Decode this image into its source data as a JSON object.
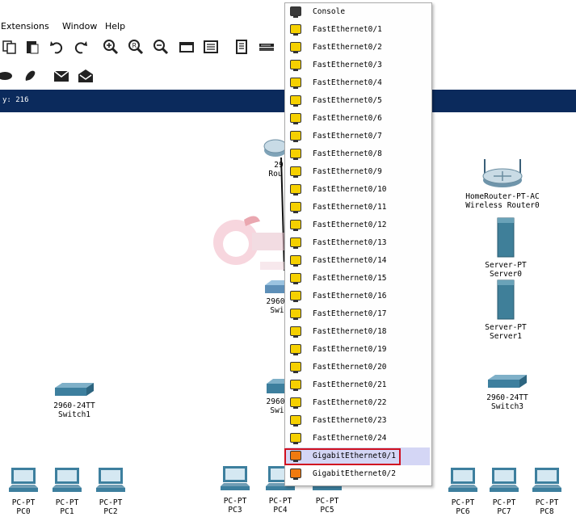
{
  "menu": {
    "extensions": "Extensions",
    "window": "Window",
    "help": "Help"
  },
  "toolbar_icons": [
    "copy-icon",
    "paste-icon",
    "undo-icon",
    "redo-icon",
    "zoom-in-icon",
    "zoom-reset-icon",
    "zoom-out-icon",
    "drawing-palette-icon",
    "custom-device-icon",
    "notes-icon",
    "cluster-icon"
  ],
  "toolbar2_icons": [
    "ellipse-icon",
    "freeform-icon",
    "add-pdu-icon",
    "add-complex-pdu-icon"
  ],
  "status": {
    "coord": "y: 216"
  },
  "devices": {
    "router_top_model": "29",
    "router_top_name": "Rou",
    "home_router_model": "HomeRouter-PT-AC",
    "home_router_name": "Wireless Router0",
    "server0_model": "Server-PT",
    "server0_name": "Server0",
    "server1_model": "Server-PT",
    "server1_name": "Server1",
    "switch_mid_model": "2960",
    "switch_mid_name": "Swi",
    "switch1_model": "2960-24TT",
    "switch1_name": "Switch1",
    "switch2_model": "2960",
    "switch2_name": "Swi",
    "switch3_model": "2960-24TT",
    "switch3_name": "Switch3",
    "pcs": [
      {
        "model": "PC-PT",
        "name": "PC0"
      },
      {
        "model": "PC-PT",
        "name": "PC1"
      },
      {
        "model": "PC-PT",
        "name": "PC2"
      },
      {
        "model": "PC-PT",
        "name": "PC3"
      },
      {
        "model": "PC-PT",
        "name": "PC4"
      },
      {
        "model": "PC-PT",
        "name": "PC5"
      },
      {
        "model": "PC-PT",
        "name": "PC6"
      },
      {
        "model": "PC-PT",
        "name": "PC7"
      },
      {
        "model": "PC-PT",
        "name": "PC8"
      }
    ]
  },
  "port_menu": {
    "items": [
      {
        "label": "Console",
        "kind": "console"
      },
      {
        "label": "FastEthernet0/1",
        "kind": "fast"
      },
      {
        "label": "FastEthernet0/2",
        "kind": "fast"
      },
      {
        "label": "FastEthernet0/3",
        "kind": "fast"
      },
      {
        "label": "FastEthernet0/4",
        "kind": "fast"
      },
      {
        "label": "FastEthernet0/5",
        "kind": "fast"
      },
      {
        "label": "FastEthernet0/6",
        "kind": "fast"
      },
      {
        "label": "FastEthernet0/7",
        "kind": "fast"
      },
      {
        "label": "FastEthernet0/8",
        "kind": "fast"
      },
      {
        "label": "FastEthernet0/9",
        "kind": "fast"
      },
      {
        "label": "FastEthernet0/10",
        "kind": "fast"
      },
      {
        "label": "FastEthernet0/11",
        "kind": "fast"
      },
      {
        "label": "FastEthernet0/12",
        "kind": "fast"
      },
      {
        "label": "FastEthernet0/13",
        "kind": "fast"
      },
      {
        "label": "FastEthernet0/14",
        "kind": "fast"
      },
      {
        "label": "FastEthernet0/15",
        "kind": "fast"
      },
      {
        "label": "FastEthernet0/16",
        "kind": "fast"
      },
      {
        "label": "FastEthernet0/17",
        "kind": "fast"
      },
      {
        "label": "FastEthernet0/18",
        "kind": "fast"
      },
      {
        "label": "FastEthernet0/19",
        "kind": "fast"
      },
      {
        "label": "FastEthernet0/20",
        "kind": "fast"
      },
      {
        "label": "FastEthernet0/21",
        "kind": "fast"
      },
      {
        "label": "FastEthernet0/22",
        "kind": "fast"
      },
      {
        "label": "FastEthernet0/23",
        "kind": "fast"
      },
      {
        "label": "FastEthernet0/24",
        "kind": "fast"
      },
      {
        "label": "GigabitEthernet0/1",
        "kind": "gigabit",
        "selected": true
      },
      {
        "label": "GigabitEthernet0/2",
        "kind": "gigabit"
      }
    ],
    "colors": {
      "console": "#3a3a3a",
      "fast": "#f5d000",
      "gigabit": "#f07a10"
    }
  },
  "colors": {
    "statusbar": "#0b2a5c",
    "highlight": "#d01020",
    "selected_row": "#d4d6f5"
  }
}
